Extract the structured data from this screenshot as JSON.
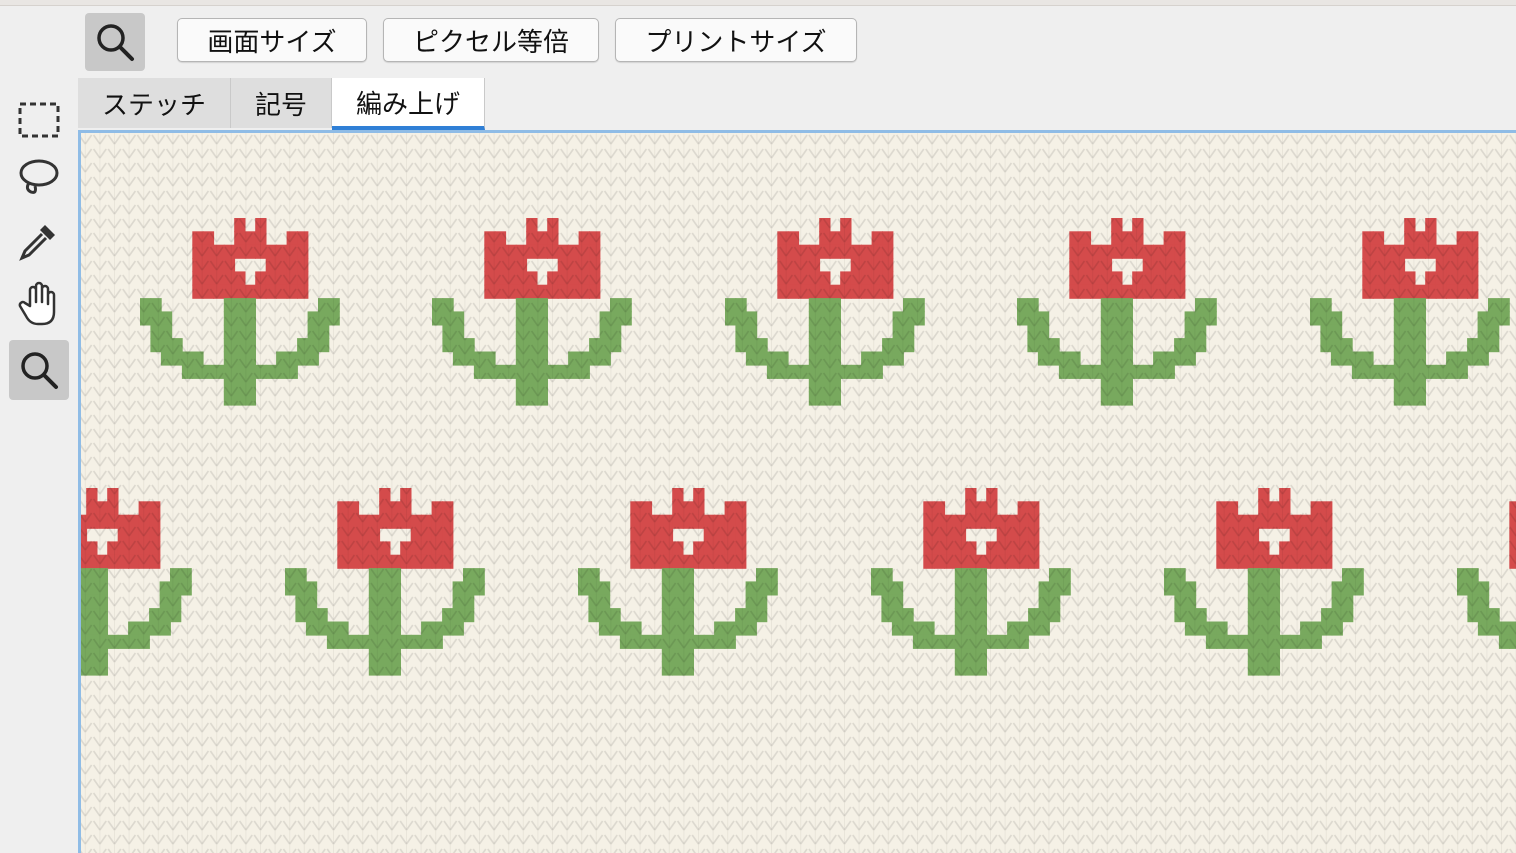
{
  "toolbar_top": {
    "zoom_tool_icon": "magnifier-icon",
    "buttons": [
      {
        "label": "画面サイズ"
      },
      {
        "label": "ピクセル等倍"
      },
      {
        "label": "プリントサイズ"
      }
    ]
  },
  "tools": [
    {
      "icon": "rectangle-select-icon"
    },
    {
      "icon": "lasso-select-icon"
    },
    {
      "icon": "eyedropper-icon"
    },
    {
      "icon": "hand-icon"
    },
    {
      "icon": "magnifier-icon"
    }
  ],
  "tabs": [
    {
      "label": "ステッチ"
    },
    {
      "label": "記号"
    },
    {
      "label": "編み上げ"
    }
  ],
  "active_tab": "編み上げ",
  "colors": {
    "yarn_background": "#f5f1e6",
    "flower_red": "#d44b4b",
    "leaf_green": "#78a95e",
    "accent_blue": "#2f7fd6"
  }
}
